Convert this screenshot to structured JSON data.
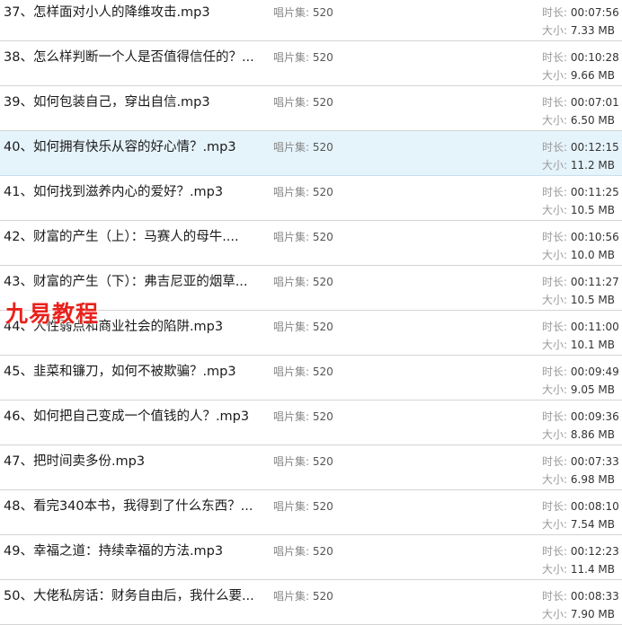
{
  "files": [
    {
      "title": "37、怎样面对小人的降维攻击.mp3",
      "album_label": "唱片集:",
      "album": "520",
      "duration_label": "时长:",
      "duration": "00:07:56",
      "size_label": "大小:",
      "size": "7.33 MB"
    },
    {
      "title": "38、怎么样判断一个人是否值得信任的？...",
      "album_label": "唱片集:",
      "album": "520",
      "duration_label": "时长:",
      "duration": "00:10:28",
      "size_label": "大小:",
      "size": "9.66 MB"
    },
    {
      "title": "39、如何包装自己，穿出自信.mp3",
      "album_label": "唱片集:",
      "album": "520",
      "duration_label": "时长:",
      "duration": "00:07:01",
      "size_label": "大小:",
      "size": "6.50 MB"
    },
    {
      "title": "40、如何拥有快乐从容的好心情？.mp3",
      "album_label": "唱片集:",
      "album": "520",
      "duration_label": "时长:",
      "duration": "00:12:15",
      "size_label": "大小:",
      "size": "11.2 MB",
      "selected": true
    },
    {
      "title": "41、如何找到滋养内心的爱好？.mp3",
      "album_label": "唱片集:",
      "album": "520",
      "duration_label": "时长:",
      "duration": "00:11:25",
      "size_label": "大小:",
      "size": "10.5 MB"
    },
    {
      "title": "42、财富的产生（上）：马赛人的母牛....",
      "album_label": "唱片集:",
      "album": "520",
      "duration_label": "时长:",
      "duration": "00:10:56",
      "size_label": "大小:",
      "size": "10.0 MB"
    },
    {
      "title": "43、财富的产生（下）：弗吉尼亚的烟草...",
      "album_label": "唱片集:",
      "album": "520",
      "duration_label": "时长:",
      "duration": "00:11:27",
      "size_label": "大小:",
      "size": "10.5 MB"
    },
    {
      "title": "44、人性弱点和商业社会的陷阱.mp3",
      "album_label": "唱片集:",
      "album": "520",
      "duration_label": "时长:",
      "duration": "00:11:00",
      "size_label": "大小:",
      "size": "10.1 MB"
    },
    {
      "title": "45、韭菜和镰刀，如何不被欺骗？.mp3",
      "album_label": "唱片集:",
      "album": "520",
      "duration_label": "时长:",
      "duration": "00:09:49",
      "size_label": "大小:",
      "size": "9.05 MB"
    },
    {
      "title": "46、如何把自己变成一个值钱的人？.mp3",
      "album_label": "唱片集:",
      "album": "520",
      "duration_label": "时长:",
      "duration": "00:09:36",
      "size_label": "大小:",
      "size": "8.86 MB"
    },
    {
      "title": "47、把时间卖多份.mp3",
      "album_label": "唱片集:",
      "album": "520",
      "duration_label": "时长:",
      "duration": "00:07:33",
      "size_label": "大小:",
      "size": "6.98 MB"
    },
    {
      "title": "48、看完340本书，我得到了什么东西？...",
      "album_label": "唱片集:",
      "album": "520",
      "duration_label": "时长:",
      "duration": "00:08:10",
      "size_label": "大小:",
      "size": "7.54 MB"
    },
    {
      "title": "49、幸福之道：持续幸福的方法.mp3",
      "album_label": "唱片集:",
      "album": "520",
      "duration_label": "时长:",
      "duration": "00:12:23",
      "size_label": "大小:",
      "size": "11.4 MB"
    },
    {
      "title": "50、大佬私房话：财务自由后，我什么要...",
      "album_label": "唱片集:",
      "album": "520",
      "duration_label": "时长:",
      "duration": "00:08:33",
      "size_label": "大小:",
      "size": "7.90 MB"
    }
  ],
  "watermark": "九易教程"
}
